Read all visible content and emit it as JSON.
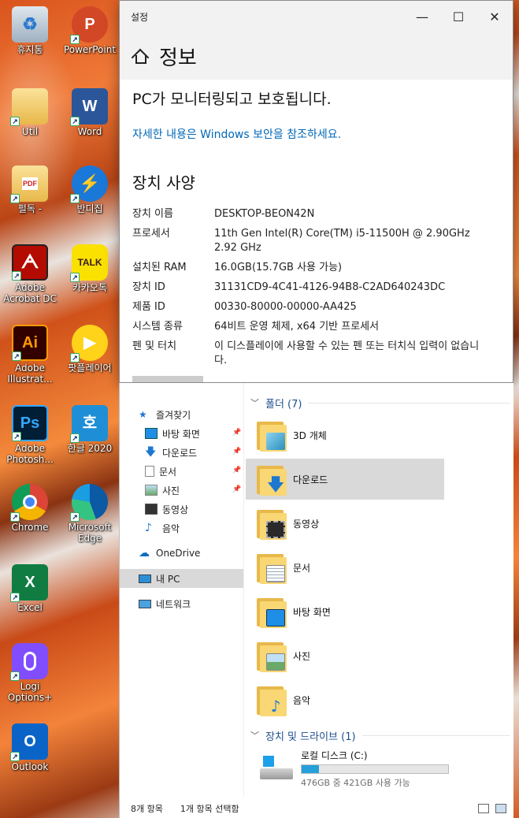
{
  "desktop": {
    "icons": [
      {
        "label": "휴지통",
        "icon": "recycle-bin-icon"
      },
      {
        "label": "PowerPoint",
        "icon": "powerpoint-icon"
      },
      {
        "label": "Util",
        "icon": "folder-icon"
      },
      {
        "label": "Word",
        "icon": "word-icon"
      },
      {
        "label": "펄독 -",
        "icon": "pdf-folder-icon"
      },
      {
        "label": "반디집",
        "icon": "bandizip-icon"
      },
      {
        "label": "Adobe Acrobat DC",
        "icon": "acrobat-icon"
      },
      {
        "label": "카카오톡",
        "icon": "kakaotalk-icon"
      },
      {
        "label": "Adobe Illustrat...",
        "icon": "illustrator-icon"
      },
      {
        "label": "팟플레이어",
        "icon": "potplayer-icon"
      },
      {
        "label": "Adobe Photosh...",
        "icon": "photoshop-icon"
      },
      {
        "label": "한글 2020",
        "icon": "hangul-icon"
      },
      {
        "label": "Chrome",
        "icon": "chrome-icon"
      },
      {
        "label": "Microsoft Edge",
        "icon": "edge-icon"
      },
      {
        "label": "Excel",
        "icon": "excel-icon"
      },
      {
        "label": "Logi Options+",
        "icon": "logi-icon"
      },
      {
        "label": "Outlook",
        "icon": "outlook-icon"
      }
    ],
    "glyphs": {
      "ppt": "P",
      "word": "W",
      "ps": "Ps",
      "ai": "Ai",
      "excel": "X",
      "outlook": "O",
      "hangul": "호",
      "kakao": "TALK"
    }
  },
  "settings": {
    "window_title": "설정",
    "page_title": "정보",
    "protect_text": "PC가 모니터링되고 보호됩니다.",
    "security_link": "자세한 내용은 Windows 보안을 참조하세요.",
    "section_title": "장치 사양",
    "specs": [
      {
        "key": "장치 이름",
        "value": "DESKTOP-BEON42N"
      },
      {
        "key": "프로세서",
        "value": "11th Gen Intel(R) Core(TM) i5-11500H @ 2.90GHz 2.92 GHz"
      },
      {
        "key": "설치된 RAM",
        "value": "16.0GB(15.7GB 사용 가능)"
      },
      {
        "key": "장치 ID",
        "value": "31131CD9-4C41-4126-94B8-C2AD640243DC"
      },
      {
        "key": "제품 ID",
        "value": "00330-80000-00000-AA425"
      },
      {
        "key": "시스템 종류",
        "value": "64비트 운영 체제, x64 기반 프로세서"
      },
      {
        "key": "펜 및 터치",
        "value": "이 디스플레이에 사용할 수 있는 펜 또는 터치식 입력이 없습니다."
      }
    ],
    "controls": {
      "minimize": "—",
      "maximize": "☐",
      "close": "✕"
    }
  },
  "explorer": {
    "nav": {
      "quick_access": "즐겨찾기",
      "items": [
        {
          "label": "바탕 화면",
          "icon": "desktop-icon",
          "pinned": true
        },
        {
          "label": "다운로드",
          "icon": "download-icon",
          "pinned": true
        },
        {
          "label": "문서",
          "icon": "documents-icon",
          "pinned": true
        },
        {
          "label": "사진",
          "icon": "pictures-icon",
          "pinned": true
        },
        {
          "label": "동영상",
          "icon": "videos-icon",
          "pinned": false
        },
        {
          "label": "음악",
          "icon": "music-icon",
          "pinned": false
        }
      ],
      "onedrive": "OneDrive",
      "this_pc": "내 PC",
      "network": "네트워크"
    },
    "folders_header": "폴더 (7)",
    "folders": [
      {
        "label": "3D 개체",
        "icon": "3d-objects-icon",
        "selected": false
      },
      {
        "label": "다운로드",
        "icon": "download-folder-icon",
        "selected": true
      },
      {
        "label": "동영상",
        "icon": "videos-folder-icon",
        "selected": false
      },
      {
        "label": "문서",
        "icon": "documents-folder-icon",
        "selected": false
      },
      {
        "label": "바탕 화면",
        "icon": "desktop-folder-icon",
        "selected": false
      },
      {
        "label": "사진",
        "icon": "pictures-folder-icon",
        "selected": false
      },
      {
        "label": "음악",
        "icon": "music-folder-icon",
        "selected": false
      }
    ],
    "drives_header": "장치 및 드라이브 (1)",
    "drive": {
      "name": "로컬 디스크 (C:)",
      "free_text": "476GB 중 421GB 사용 가능",
      "used_fraction": 0.116
    },
    "status": {
      "count": "8개 항목",
      "selected": "1개 항목 선택함"
    },
    "colors": {
      "accent": "#0067b8",
      "drive_fill": "#26a0da"
    }
  }
}
